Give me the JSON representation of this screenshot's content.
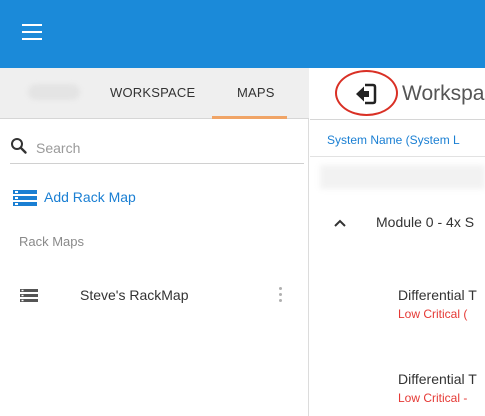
{
  "topbar": {
    "color": "#1b8ad9",
    "menu_icon": "hamburger-menu-icon"
  },
  "sidebar": {
    "tabs": [
      {
        "label": "WORKSPACE",
        "active": false
      },
      {
        "label": "MAPS",
        "active": true
      }
    ],
    "active_tab_color": "#f0a466",
    "search": {
      "placeholder": "Search",
      "value": "",
      "icon": "search-icon"
    },
    "add_rack_map": {
      "label": "Add Rack Map",
      "icon": "rack-add-icon",
      "color": "#1a7fd3"
    },
    "section_label": "Rack Maps",
    "rack_maps": [
      {
        "label": "Steve's RackMap",
        "icon": "rack-icon"
      }
    ]
  },
  "main": {
    "back_icon": "back-arrow-icon",
    "title": "Workspa",
    "column_header": "System Name (System L",
    "module": {
      "label": "Module 0 - 4x S",
      "expanded": true
    },
    "sensors": [
      {
        "name": "Differential T",
        "status": "Low Critical ("
      },
      {
        "name": "Differential T",
        "status": "Low Critical -"
      }
    ],
    "status_color": "#e53935",
    "highlight_color": "#d93025"
  }
}
